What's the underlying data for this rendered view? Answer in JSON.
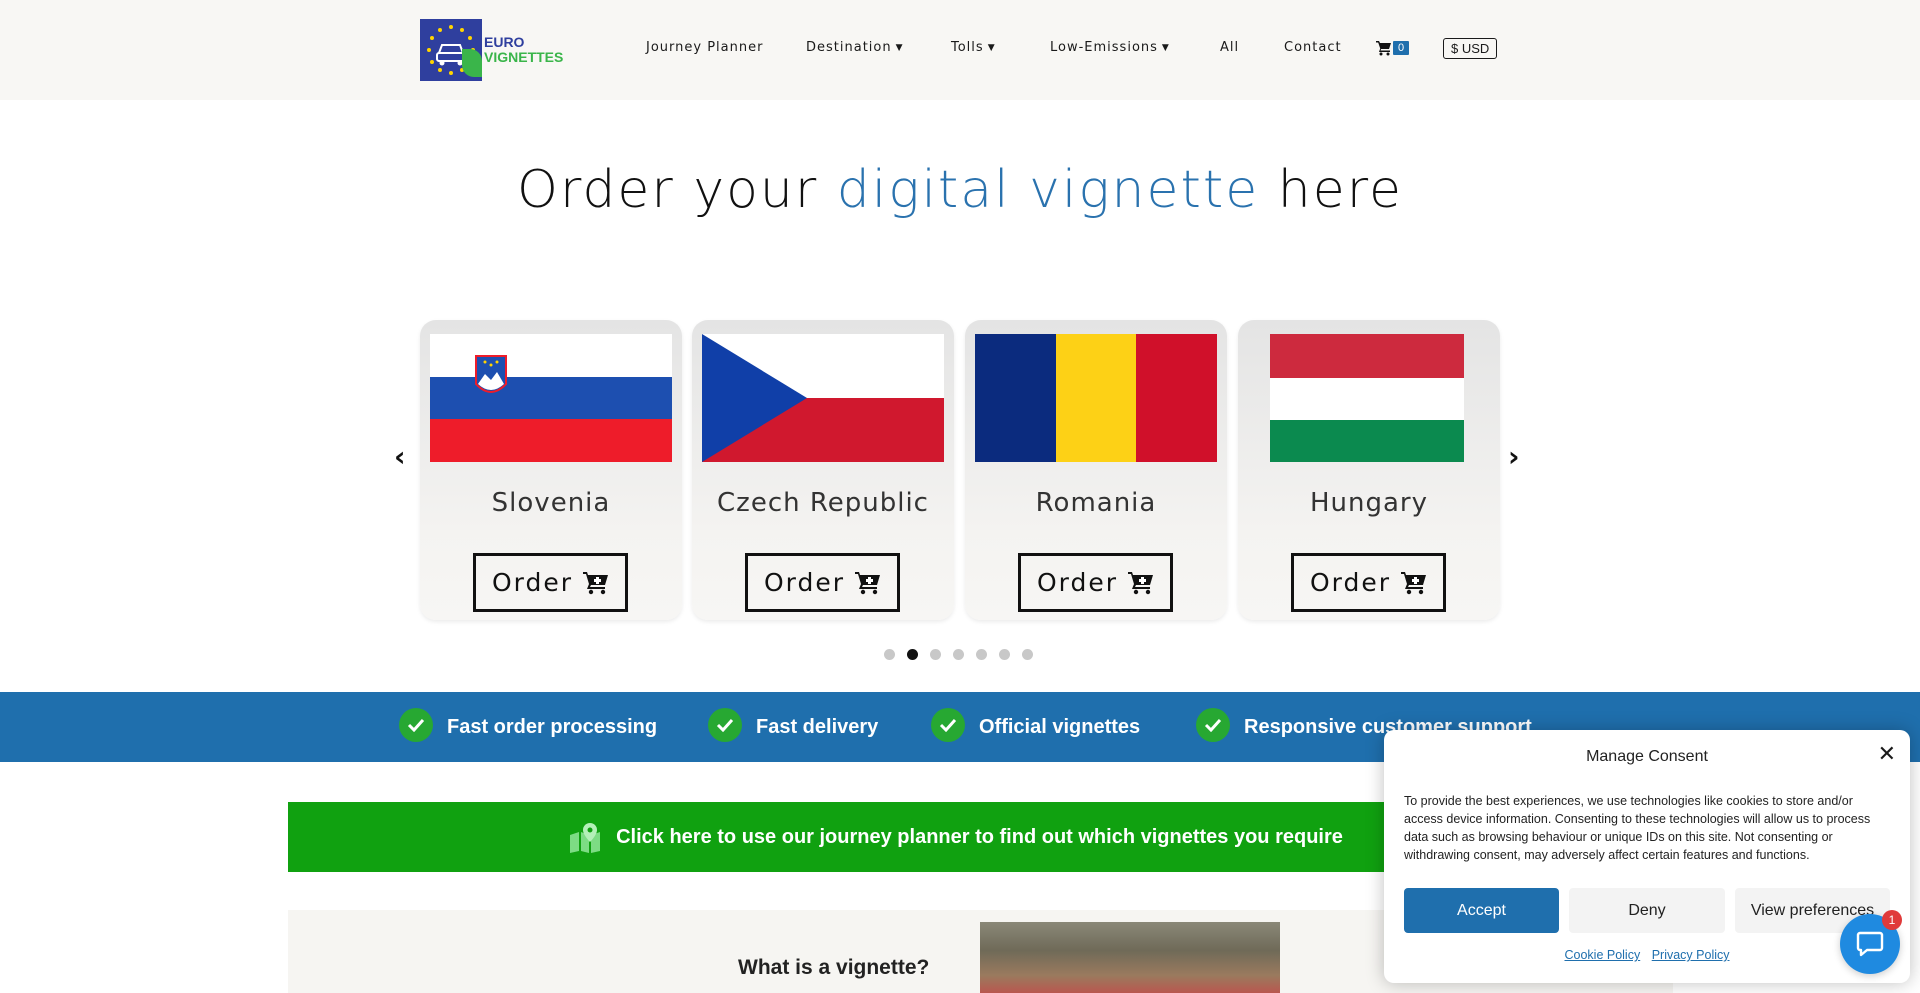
{
  "brand": {
    "logo_line1": "EURO",
    "logo_line2": "VIGNETTES",
    "colors": {
      "primary": "#1f6fad",
      "accent_text": "#2a72ae",
      "cta_green": "#10a110",
      "check_green": "#27a832"
    }
  },
  "nav": {
    "items": [
      {
        "label": "Journey Planner",
        "has_dropdown": false
      },
      {
        "label": "Destination",
        "has_dropdown": true
      },
      {
        "label": "Tolls",
        "has_dropdown": true
      },
      {
        "label": "Low-Emissions",
        "has_dropdown": true
      },
      {
        "label": "All",
        "has_dropdown": false
      },
      {
        "label": "Contact",
        "has_dropdown": false
      }
    ],
    "dropdown_icon": "chevron-down-icon",
    "cart_icon": "cart-icon",
    "cart_count": "0",
    "currency": "$ USD"
  },
  "hero": {
    "title_before": "Order your ",
    "title_accent": "digital vignette",
    "title_after": " here"
  },
  "carousel": {
    "prev_icon": "chevron-left-icon",
    "next_icon": "chevron-right-icon",
    "cards": [
      {
        "name": "Slovenia",
        "button": "Order",
        "flag": "slovenia"
      },
      {
        "name": "Czech Republic",
        "button": "Order",
        "flag": "czech"
      },
      {
        "name": "Romania",
        "button": "Order",
        "flag": "romania"
      },
      {
        "name": "Hungary",
        "button": "Order",
        "flag": "hungary"
      }
    ],
    "dot_count": 7,
    "active_dot": 2
  },
  "features": [
    {
      "label": "Fast order processing",
      "icon": "check-circle-icon"
    },
    {
      "label": "Fast delivery",
      "icon": "check-circle-icon"
    },
    {
      "label": "Official vignettes",
      "icon": "check-circle-icon"
    },
    {
      "label": "Responsive customer support",
      "icon": "check-circle-icon"
    }
  ],
  "cta": {
    "label": "Click here to use our journey planner to find out which vignettes you require",
    "icon": "map-pin-icon"
  },
  "info": {
    "title": "What is a vignette?"
  },
  "consent": {
    "title": "Manage Consent",
    "text": "To provide the best experiences, we use technologies like cookies to store and/or access device information. Consenting to these technologies will allow us to process data such as browsing behaviour or unique IDs on this site. Not consenting or withdrawing consent, may adversely affect certain features and functions.",
    "accept": "Accept",
    "deny": "Deny",
    "preferences": "View preferences",
    "cookie_policy": "Cookie Policy",
    "privacy_policy": "Privacy Policy",
    "close_icon": "close-icon"
  },
  "chat": {
    "badge": "1",
    "icon": "chat-icon"
  }
}
